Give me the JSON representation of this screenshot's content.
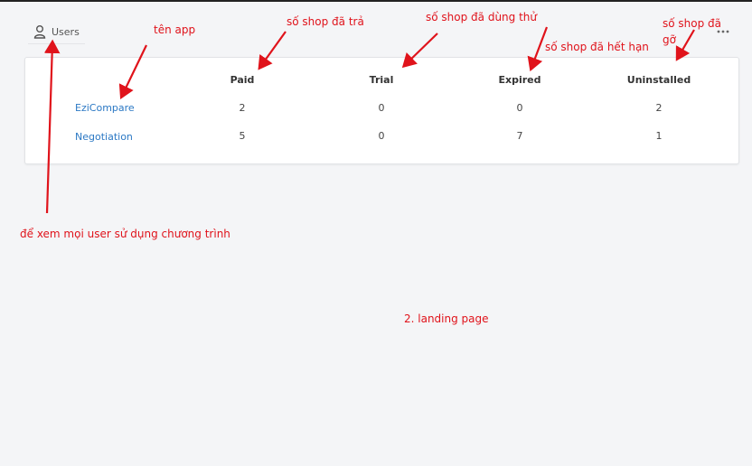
{
  "nav": {
    "users_label": "Users"
  },
  "table": {
    "headers": [
      "Paid",
      "Trial",
      "Expired",
      "Uninstalled"
    ],
    "rows": [
      {
        "app": "EziCompare",
        "values": [
          "2",
          "0",
          "0",
          "2"
        ]
      },
      {
        "app": "Negotiation",
        "values": [
          "5",
          "0",
          "7",
          "1"
        ]
      }
    ]
  },
  "annotations": {
    "ten_app": "tên app",
    "paid": "số shop đã trả",
    "trial": "số shop đã dùng thử",
    "expired": "số shop đã hết hạn",
    "uninstalled_1": "số shop đã",
    "uninstalled_2": "gỡ",
    "users": "để xem mọi user sử dụng chương trình",
    "landing": "2. landing page"
  },
  "colors": {
    "annotation": "#e0131b",
    "link": "#2b78c4"
  }
}
